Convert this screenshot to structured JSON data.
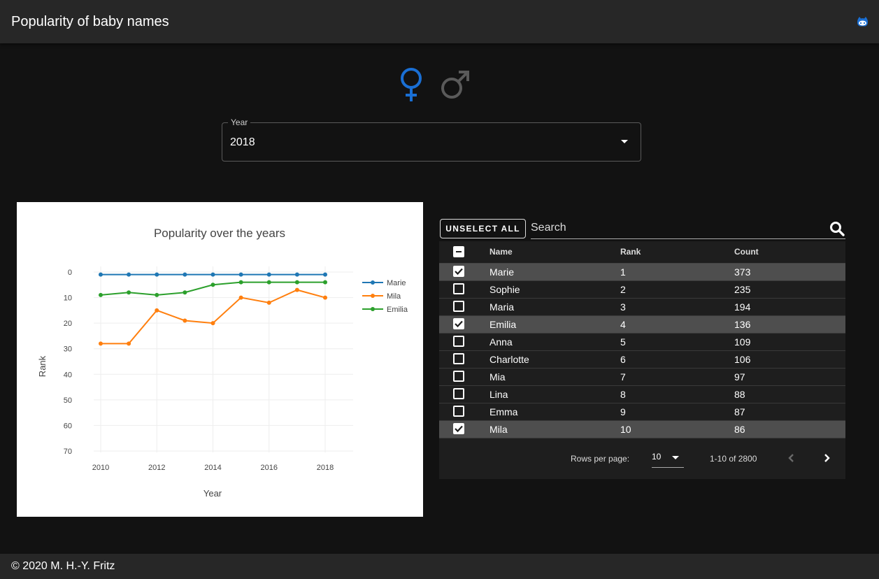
{
  "app": {
    "title": "Popularity of baby names",
    "github_icon": "github-icon"
  },
  "gender_toggle": {
    "female_icon": "female-symbol-icon",
    "male_icon": "male-symbol-icon",
    "selected": "female",
    "active_color": "#1a6fd4",
    "inactive_color": "#5a5a5a"
  },
  "year_select": {
    "label": "Year",
    "value": "2018"
  },
  "chart_data": {
    "type": "line",
    "title": "Popularity over the years",
    "xlabel": "Year",
    "ylabel": "Rank",
    "x_ticks": [
      "2010",
      "2012",
      "2014",
      "2016",
      "2018"
    ],
    "y_ticks": [
      "0",
      "10",
      "20",
      "30",
      "40",
      "50",
      "60",
      "70"
    ],
    "xlim": [
      2010,
      2018
    ],
    "ylim": [
      0,
      70
    ],
    "y_reversed": true,
    "grid": true,
    "legend": "top-right",
    "x": [
      2010,
      2011,
      2012,
      2013,
      2014,
      2015,
      2016,
      2017,
      2018
    ],
    "series": [
      {
        "name": "Marie",
        "color": "#1f77b4",
        "values": [
          1,
          1,
          1,
          1,
          1,
          1,
          1,
          1,
          1
        ]
      },
      {
        "name": "Mila",
        "color": "#ff7f0e",
        "values": [
          28,
          28,
          15,
          19,
          20,
          10,
          12,
          7,
          10
        ]
      },
      {
        "name": "Emilia",
        "color": "#2ca02c",
        "values": [
          9,
          8,
          9,
          8,
          5,
          4,
          4,
          4,
          4
        ]
      }
    ]
  },
  "table": {
    "unselect_label": "Unselect All",
    "search_placeholder": "Search",
    "headers": {
      "name": "Name",
      "rank": "Rank",
      "count": "Count"
    },
    "rows": [
      {
        "name": "Marie",
        "rank": "1",
        "count": "373",
        "selected": true
      },
      {
        "name": "Sophie",
        "rank": "2",
        "count": "235",
        "selected": false
      },
      {
        "name": "Maria",
        "rank": "3",
        "count": "194",
        "selected": false
      },
      {
        "name": "Emilia",
        "rank": "4",
        "count": "136",
        "selected": true
      },
      {
        "name": "Anna",
        "rank": "5",
        "count": "109",
        "selected": false
      },
      {
        "name": "Charlotte",
        "rank": "6",
        "count": "106",
        "selected": false
      },
      {
        "name": "Mia",
        "rank": "7",
        "count": "97",
        "selected": false
      },
      {
        "name": "Lina",
        "rank": "8",
        "count": "88",
        "selected": false
      },
      {
        "name": "Emma",
        "rank": "9",
        "count": "87",
        "selected": false
      },
      {
        "name": "Mila",
        "rank": "10",
        "count": "86",
        "selected": true
      }
    ],
    "pagination": {
      "rows_per_page_label": "Rows per page:",
      "rows_per_page": "10",
      "range": "1-10 of 2800"
    }
  },
  "footer": {
    "text": "© 2020 M. H.-Y. Fritz"
  }
}
